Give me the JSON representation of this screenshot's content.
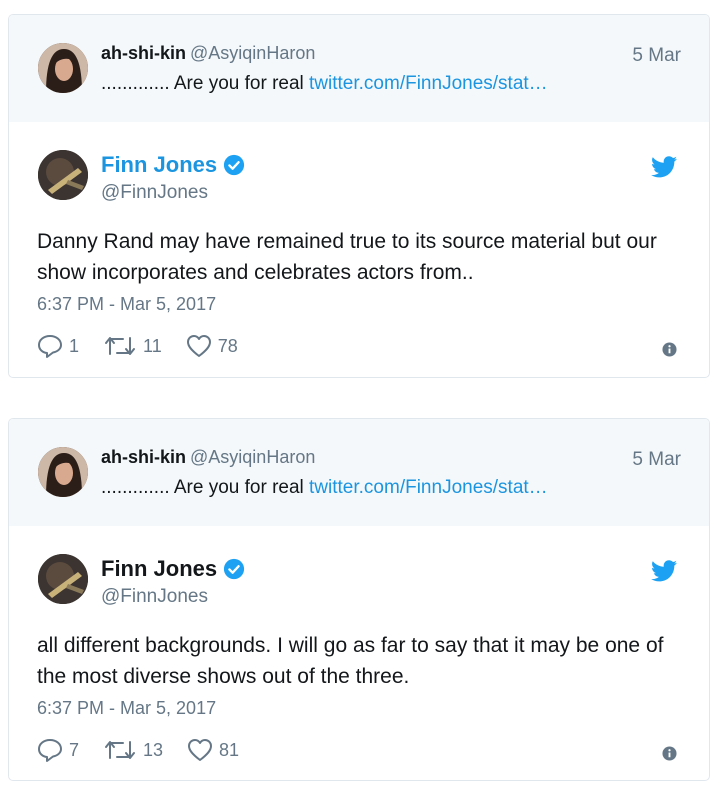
{
  "tweets": [
    {
      "reply": {
        "display_name": "ah-shi-kin",
        "handle": "@AsyiqinHaron",
        "date": "5 Mar",
        "text": "............. Are you for real",
        "link": "twitter.com/FinnJones/stat…"
      },
      "main": {
        "display_name": "Finn Jones",
        "handle": "@FinnJones",
        "body": "Danny Rand may have remained true to its source material but our show incorporates and celebrates actors from..",
        "timestamp": "6:37 PM - Mar 5, 2017",
        "replies": "1",
        "retweets": "11",
        "likes": "78"
      }
    },
    {
      "reply": {
        "display_name": "ah-shi-kin",
        "handle": "@AsyiqinHaron",
        "date": "5 Mar",
        "text": "............. Are you for real",
        "link": "twitter.com/FinnJones/stat…"
      },
      "main": {
        "display_name": "Finn Jones",
        "handle": "@FinnJones",
        "body": "all different backgrounds. I will go as far to say that it may be one of the most diverse shows out of the three.",
        "timestamp": "6:37 PM - Mar 5, 2017",
        "replies": "7",
        "retweets": "13",
        "likes": "81"
      }
    }
  ],
  "colors": {
    "link": "#1b95e0",
    "muted": "#657786",
    "reply_bg": "#f5f8fa",
    "border": "#e1e8ed"
  },
  "icons": [
    "verified-badge-icon",
    "twitter-bird-icon",
    "reply-icon",
    "retweet-icon",
    "like-heart-icon",
    "info-icon"
  ]
}
